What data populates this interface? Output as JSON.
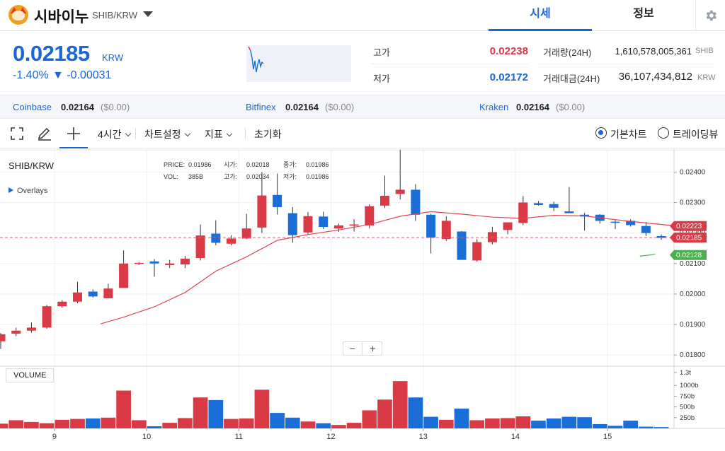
{
  "header": {
    "coin_name": "시바이누",
    "pair": "SHIB/KRW",
    "tabs": [
      "시세",
      "정보"
    ],
    "icons": {
      "logo": "shiba-logo",
      "dropdown": "triangle-down-icon",
      "settings": "gear-icon"
    }
  },
  "ticker": {
    "price": "0.02185",
    "unit": "KRW",
    "change_rate": "-1.40%",
    "change_amount": "▼ -0.00031",
    "high_label": "고가",
    "high_value": "0.02238",
    "low_label": "저가",
    "low_value": "0.02172",
    "volume_label": "거래량(24H)",
    "volume_value": "1,610,578,005,361",
    "volume_unit": "SHIB",
    "turnover_label": "거래대금(24H)",
    "turnover_value": "36,107,434,812",
    "turnover_unit": "KRW"
  },
  "exchanges": [
    {
      "name": "Coinbase",
      "price": "0.02164",
      "usd": "($0.00)"
    },
    {
      "name": "Bitfinex",
      "price": "0.02164",
      "usd": "($0.00)"
    },
    {
      "name": "Kraken",
      "price": "0.02164",
      "usd": "($0.00)"
    }
  ],
  "toolbar": {
    "interval": "4시간",
    "chart_settings": "차트설정",
    "indicators": "지표",
    "reset": "초기화",
    "view_basic": "기본차트",
    "view_tradingview": "트레이딩뷰",
    "selected_view": "기본차트",
    "icons": [
      "fullscreen-icon",
      "pencil-icon",
      "crosshair-icon"
    ]
  },
  "chart_data": {
    "type": "candlestick",
    "pair_label": "SHIB/KRW",
    "overlays_label": "Overlays",
    "info": {
      "price_label": "PRICE:",
      "price": "0.01986",
      "open_label": "시가:",
      "open": "0.02018",
      "close_label": "종가:",
      "close": "0.01986",
      "vol_label": "VOL:",
      "vol": "385B",
      "high_label": "고가:",
      "high": "0.02034",
      "low_label": "저가:",
      "low": "0.01986"
    },
    "price_ticks": [
      "0.02400",
      "0.02300",
      "0.02200",
      "0.02100",
      "0.02000",
      "0.01900",
      "0.01800"
    ],
    "price_range": [
      0.01775,
      0.02475
    ],
    "volume_label": "VOLUME",
    "volume_ticks": [
      "1.3t",
      "1000b",
      "750b",
      "500b",
      "250b"
    ],
    "volume_tick_values": [
      1300,
      1000,
      750,
      500,
      250
    ],
    "date_labels": [
      "9",
      "10",
      "11",
      "12",
      "13",
      "14",
      "15"
    ],
    "date_label_index": [
      3.5,
      9.5,
      15.5,
      21.5,
      27.5,
      33.5,
      39.5
    ],
    "price_tags": [
      {
        "value": "0.02223",
        "color": "#d93a46"
      },
      {
        "value": "0.02185",
        "color": "#d93a46"
      },
      {
        "value": "0.02128",
        "color": "#4cae4f"
      }
    ],
    "colors": {
      "up": "#d93a46",
      "down": "#1a6ed8",
      "ma": "#e0454f",
      "dashed": "#e06070"
    },
    "candles": [
      {
        "o": 0.01845,
        "h": 0.01872,
        "l": 0.0182,
        "c": 0.01868
      },
      {
        "o": 0.0187,
        "h": 0.0189,
        "l": 0.01862,
        "c": 0.0188
      },
      {
        "o": 0.0188,
        "h": 0.01907,
        "l": 0.01873,
        "c": 0.0189
      },
      {
        "o": 0.0189,
        "h": 0.01964,
        "l": 0.01886,
        "c": 0.0196
      },
      {
        "o": 0.0196,
        "h": 0.0198,
        "l": 0.01955,
        "c": 0.01975
      },
      {
        "o": 0.01975,
        "h": 0.0204,
        "l": 0.0197,
        "c": 0.02005
      },
      {
        "o": 0.02008,
        "h": 0.02015,
        "l": 0.01988,
        "c": 0.01992
      },
      {
        "o": 0.01986,
        "h": 0.02034,
        "l": 0.01986,
        "c": 0.02018
      },
      {
        "o": 0.0202,
        "h": 0.02143,
        "l": 0.02054,
        "c": 0.021
      },
      {
        "o": 0.021,
        "h": 0.02105,
        "l": 0.02095,
        "c": 0.02102
      },
      {
        "o": 0.02107,
        "h": 0.02115,
        "l": 0.02057,
        "c": 0.021
      },
      {
        "o": 0.02095,
        "h": 0.02112,
        "l": 0.02085,
        "c": 0.021
      },
      {
        "o": 0.02097,
        "h": 0.02125,
        "l": 0.02085,
        "c": 0.02116
      },
      {
        "o": 0.02118,
        "h": 0.02228,
        "l": 0.0211,
        "c": 0.02192
      },
      {
        "o": 0.02198,
        "h": 0.02242,
        "l": 0.0216,
        "c": 0.02168
      },
      {
        "o": 0.02165,
        "h": 0.02193,
        "l": 0.0216,
        "c": 0.02182
      },
      {
        "o": 0.02182,
        "h": 0.02263,
        "l": 0.0218,
        "c": 0.02215
      },
      {
        "o": 0.02218,
        "h": 0.024,
        "l": 0.022,
        "c": 0.02323
      },
      {
        "o": 0.02325,
        "h": 0.02395,
        "l": 0.02261,
        "c": 0.02285
      },
      {
        "o": 0.02265,
        "h": 0.02285,
        "l": 0.02168,
        "c": 0.02193
      },
      {
        "o": 0.02202,
        "h": 0.02269,
        "l": 0.02195,
        "c": 0.02255
      },
      {
        "o": 0.02254,
        "h": 0.0227,
        "l": 0.02213,
        "c": 0.0222
      },
      {
        "o": 0.02215,
        "h": 0.02231,
        "l": 0.02204,
        "c": 0.02225
      },
      {
        "o": 0.02225,
        "h": 0.02245,
        "l": 0.02205,
        "c": 0.02228
      },
      {
        "o": 0.02225,
        "h": 0.02294,
        "l": 0.02215,
        "c": 0.02288
      },
      {
        "o": 0.0229,
        "h": 0.02388,
        "l": 0.02282,
        "c": 0.02322
      },
      {
        "o": 0.02328,
        "h": 0.02473,
        "l": 0.0231,
        "c": 0.02342
      },
      {
        "o": 0.02342,
        "h": 0.0236,
        "l": 0.0224,
        "c": 0.0226
      },
      {
        "o": 0.0226,
        "h": 0.02263,
        "l": 0.02133,
        "c": 0.02185
      },
      {
        "o": 0.0218,
        "h": 0.02255,
        "l": 0.02174,
        "c": 0.0224
      },
      {
        "o": 0.02205,
        "h": 0.02206,
        "l": 0.02112,
        "c": 0.02112
      },
      {
        "o": 0.0211,
        "h": 0.0218,
        "l": 0.02106,
        "c": 0.0217
      },
      {
        "o": 0.0217,
        "h": 0.0222,
        "l": 0.02163,
        "c": 0.02203
      },
      {
        "o": 0.0221,
        "h": 0.02225,
        "l": 0.02196,
        "c": 0.02235
      },
      {
        "o": 0.02233,
        "h": 0.02321,
        "l": 0.02226,
        "c": 0.023
      },
      {
        "o": 0.02298,
        "h": 0.02305,
        "l": 0.0229,
        "c": 0.02292
      },
      {
        "o": 0.02295,
        "h": 0.02303,
        "l": 0.02272,
        "c": 0.02283
      },
      {
        "o": 0.02271,
        "h": 0.02351,
        "l": 0.02265,
        "c": 0.02265
      },
      {
        "o": 0.0226,
        "h": 0.02266,
        "l": 0.02208,
        "c": 0.02254
      },
      {
        "o": 0.0226,
        "h": 0.02262,
        "l": 0.02231,
        "c": 0.0224
      },
      {
        "o": 0.02237,
        "h": 0.02242,
        "l": 0.02213,
        "c": 0.02236
      },
      {
        "o": 0.0224,
        "h": 0.02245,
        "l": 0.02221,
        "c": 0.02226
      },
      {
        "o": 0.02223,
        "h": 0.02236,
        "l": 0.0219,
        "c": 0.022
      },
      {
        "o": 0.0219,
        "h": 0.02195,
        "l": 0.02178,
        "c": 0.02184
      }
    ],
    "volumes": [
      110,
      190,
      150,
      120,
      200,
      220,
      230,
      250,
      880,
      190,
      50,
      130,
      240,
      720,
      660,
      220,
      230,
      900,
      360,
      250,
      160,
      120,
      80,
      130,
      420,
      670,
      1100,
      720,
      270,
      200,
      460,
      190,
      230,
      240,
      280,
      180,
      230,
      270,
      260,
      100,
      60,
      180,
      40,
      30
    ],
    "ma_line": [
      [
        6.5,
        0.01902
      ],
      [
        8,
        0.01924
      ],
      [
        10,
        0.01958
      ],
      [
        12,
        0.02005
      ],
      [
        14,
        0.02075
      ],
      [
        16,
        0.02122
      ],
      [
        18,
        0.02176
      ],
      [
        20,
        0.02195
      ],
      [
        22,
        0.0221
      ],
      [
        24,
        0.02228
      ],
      [
        26,
        0.02255
      ],
      [
        28,
        0.0227
      ],
      [
        30,
        0.02262
      ],
      [
        32,
        0.02252
      ],
      [
        34,
        0.02248
      ],
      [
        36,
        0.02258
      ],
      [
        38,
        0.02256
      ],
      [
        40,
        0.02244
      ],
      [
        42,
        0.02233
      ],
      [
        43.6,
        0.02225
      ]
    ],
    "green_line": [
      [
        41.6,
        0.02124
      ],
      [
        42.6,
        0.0213
      ]
    ]
  }
}
